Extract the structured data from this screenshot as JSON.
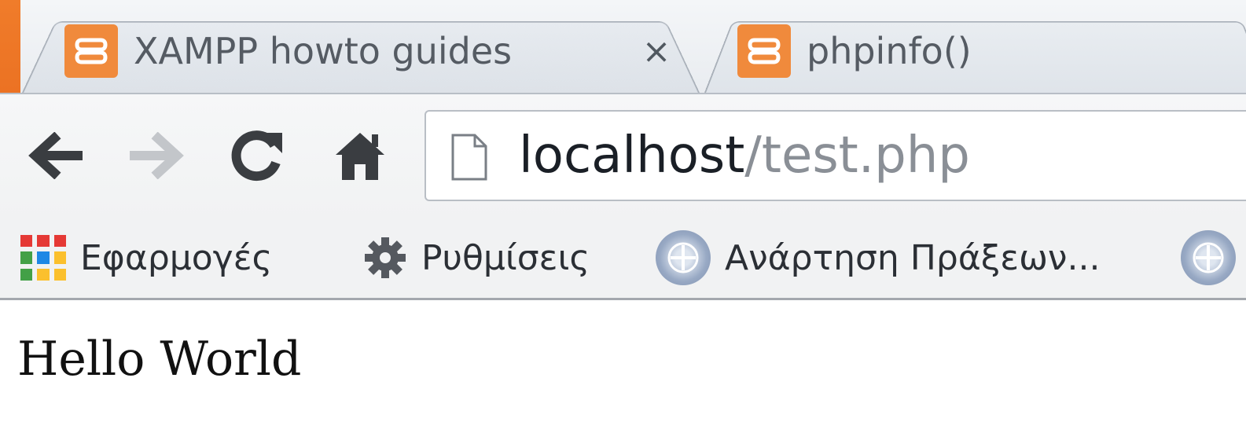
{
  "colors": {
    "favicon": "#f08a3c",
    "apps_grid": [
      "#e53935",
      "#e53935",
      "#e53935",
      "#43a047",
      "#1e88e5",
      "#fbc02d",
      "#43a047",
      "#fbc02d",
      "#fbc02d"
    ]
  },
  "tabs": [
    {
      "title": "XAMPP howto guides",
      "icon": "xampp-icon",
      "active": true,
      "close_label": "×"
    },
    {
      "title": "phpinfo()",
      "icon": "xampp-icon",
      "active": false
    }
  ],
  "toolbar": {
    "back_icon": "back-arrow-icon",
    "forward_icon": "forward-arrow-icon",
    "reload_icon": "reload-icon",
    "home_icon": "home-icon"
  },
  "omnibox": {
    "page_icon": "page-icon",
    "url_host": "localhost",
    "url_path": "/test.php"
  },
  "bookmarks": [
    {
      "label": "Εφαρμογές",
      "icon": "apps-grid-icon"
    },
    {
      "label": "Ρυθμίσεις",
      "icon": "gear-icon"
    },
    {
      "label": "Ανάρτηση Πράξεων...",
      "icon": "emblem-icon"
    },
    {
      "label": "",
      "icon": "emblem-icon"
    }
  ],
  "page": {
    "text": "Hello World"
  }
}
